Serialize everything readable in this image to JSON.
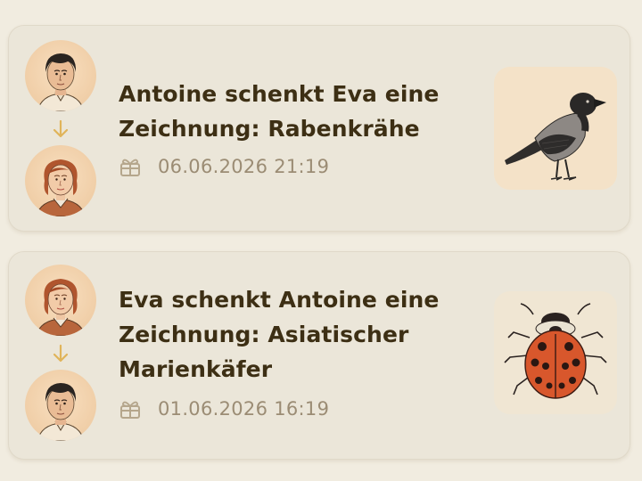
{
  "feed": {
    "items": [
      {
        "from": "Antoine",
        "to": "Eva",
        "title": "Antoine schenkt Eva eine Zeichnung: Rabenkrähe",
        "timestamp": "06.06.2026 21:19",
        "artwork": "crow-drawing",
        "gift_icon": "gift-icon"
      },
      {
        "from": "Eva",
        "to": "Antoine",
        "title": "Eva schenkt Antoine eine Zeichnung: Asiatischer Marienkäfer",
        "timestamp": "01.06.2026 16:19",
        "artwork": "ladybug-drawing",
        "gift_icon": "gift-icon"
      }
    ]
  },
  "colors": {
    "background": "#f1ece0",
    "card": "#ebe6d9",
    "title": "#3d2f14",
    "muted": "#9b8c74",
    "arrow": "#e0b45a"
  }
}
